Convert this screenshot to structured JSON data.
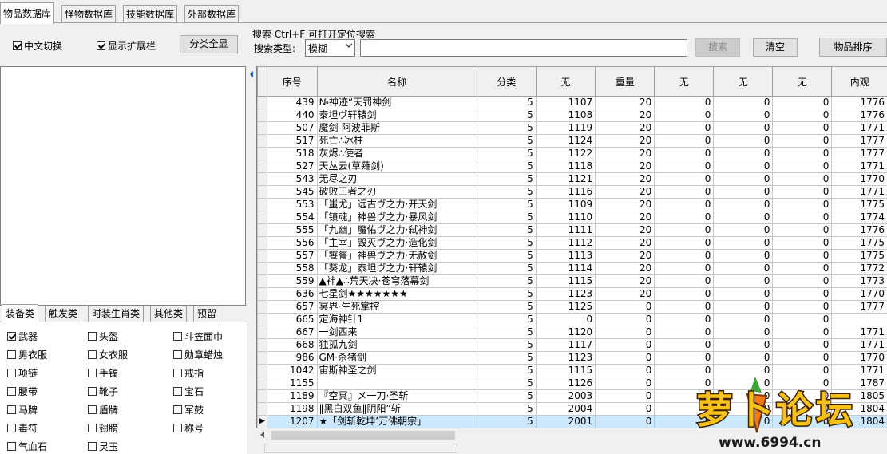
{
  "tabs": [
    {
      "label": "物品数据库",
      "active": true
    },
    {
      "label": "怪物数据库",
      "active": false
    },
    {
      "label": "技能数据库",
      "active": false
    },
    {
      "label": "外部数据库",
      "active": false
    }
  ],
  "toolbar": {
    "chinese_switch": {
      "label": "中文切换",
      "checked": true
    },
    "show_extension": {
      "label": "显示扩展栏",
      "checked": true
    },
    "show_all_label": "分类全显",
    "search_caption": "搜索   Ctrl+F 可打开定位搜索",
    "search_type_label": "搜索类型:",
    "search_type_value": "模糊",
    "search_input_value": "",
    "search_button": "搜索",
    "clear_button": "清空",
    "sort_button": "物品排序"
  },
  "category_tabs": [
    {
      "label": "装备类",
      "active": true
    },
    {
      "label": "触发类",
      "active": false
    },
    {
      "label": "时装生肖类",
      "active": false
    },
    {
      "label": "其他类",
      "active": false
    },
    {
      "label": "预留",
      "active": false
    }
  ],
  "categories": [
    {
      "label": "武器",
      "checked": true
    },
    {
      "label": "头盔",
      "checked": false
    },
    {
      "label": "斗笠面巾",
      "checked": false
    },
    {
      "label": "男衣服",
      "checked": false
    },
    {
      "label": "女衣服",
      "checked": false
    },
    {
      "label": "勋章蜡烛",
      "checked": false
    },
    {
      "label": "项链",
      "checked": false
    },
    {
      "label": "手镯",
      "checked": false
    },
    {
      "label": "戒指",
      "checked": false
    },
    {
      "label": "腰带",
      "checked": false
    },
    {
      "label": "靴子",
      "checked": false
    },
    {
      "label": "宝石",
      "checked": false
    },
    {
      "label": "马牌",
      "checked": false
    },
    {
      "label": "盾牌",
      "checked": false
    },
    {
      "label": "军鼓",
      "checked": false
    },
    {
      "label": "毒符",
      "checked": false
    },
    {
      "label": "翅膀",
      "checked": false
    },
    {
      "label": "称号",
      "checked": false
    },
    {
      "label": "气血石",
      "checked": false
    },
    {
      "label": "灵玉",
      "checked": false
    }
  ],
  "table": {
    "columns": [
      "序号",
      "名称",
      "分类",
      "无",
      "重量",
      "无",
      "无",
      "无",
      "内观"
    ],
    "rows": [
      [
        "439",
        "№神迹“天罚神剑",
        "5",
        "1107",
        "20",
        "0",
        "0",
        "0",
        "1776"
      ],
      [
        "440",
        "泰坦ヴ轩辕剑",
        "5",
        "1108",
        "20",
        "0",
        "0",
        "0",
        "1776"
      ],
      [
        "507",
        "魔剑-阿波菲斯",
        "5",
        "1119",
        "20",
        "0",
        "0",
        "0",
        "1771"
      ],
      [
        "517",
        "死亡∴冰柱",
        "5",
        "1124",
        "20",
        "0",
        "0",
        "0",
        "1777"
      ],
      [
        "518",
        "灰烬∴使者",
        "5",
        "1122",
        "20",
        "0",
        "0",
        "0",
        "1777"
      ],
      [
        "527",
        "天丛云(草薙剑)",
        "5",
        "1118",
        "20",
        "0",
        "0",
        "0",
        "1771"
      ],
      [
        "543",
        "无尽之刃",
        "5",
        "1121",
        "20",
        "0",
        "0",
        "0",
        "1770"
      ],
      [
        "545",
        "破败王者之刃",
        "5",
        "1116",
        "20",
        "0",
        "0",
        "0",
        "1771"
      ],
      [
        "553",
        "「蚩尤」远古ヴ之力·开天剑",
        "5",
        "1109",
        "20",
        "0",
        "0",
        "0",
        "1775"
      ],
      [
        "554",
        "「镇魂」神兽ヴ之力·暴风剑",
        "5",
        "1110",
        "20",
        "0",
        "0",
        "0",
        "1774"
      ],
      [
        "555",
        "「九幽」魔佑ヴ之力·弑神剑",
        "5",
        "1111",
        "20",
        "0",
        "0",
        "0",
        "1776"
      ],
      [
        "556",
        "「主宰」毁灭ヴ之力·造化剑",
        "5",
        "1112",
        "20",
        "0",
        "0",
        "0",
        "1775"
      ],
      [
        "557",
        "「饕餮」神兽ヴ之力·无赦剑",
        "5",
        "1113",
        "20",
        "0",
        "0",
        "0",
        "1775"
      ],
      [
        "558",
        "「葵龙」泰坦ヴ之力·轩辕剑",
        "5",
        "1114",
        "20",
        "0",
        "0",
        "0",
        "1772"
      ],
      [
        "559",
        "▲神▲∴荒天决·苍穹落幕剑",
        "5",
        "1115",
        "20",
        "0",
        "0",
        "0",
        "1773"
      ],
      [
        "636",
        "七星剑★★★★★★★",
        "5",
        "1123",
        "20",
        "0",
        "0",
        "0",
        "1770"
      ],
      [
        "657",
        "冥界·生死掌控",
        "5",
        "1125",
        "0",
        "0",
        "0",
        "0",
        "1777"
      ],
      [
        "665",
        "定海神针1",
        "5",
        "0",
        "0",
        "0",
        "0",
        "0",
        ""
      ],
      [
        "667",
        "一剑西来",
        "5",
        "1120",
        "0",
        "0",
        "0",
        "0",
        "1771"
      ],
      [
        "668",
        "独孤九剑",
        "5",
        "1117",
        "0",
        "0",
        "0",
        "0",
        "1771"
      ],
      [
        "986",
        "GM·杀猪剑",
        "5",
        "1123",
        "0",
        "0",
        "0",
        "0",
        "1770"
      ],
      [
        "1042",
        "宙斯神圣之剑",
        "5",
        "1115",
        "0",
        "0",
        "0",
        "0",
        "1771"
      ],
      [
        "1155",
        "",
        "5",
        "1126",
        "0",
        "0",
        "0",
        "0",
        "1787"
      ],
      [
        "1189",
        "『空冥』メ一刀·圣斩",
        "5",
        "2003",
        "0",
        "0",
        "0",
        "0",
        "1805"
      ],
      [
        "1198",
        "‖黑白双鱼‖阴阳”斩",
        "5",
        "2004",
        "0",
        "0",
        "0",
        "0",
        "1804"
      ],
      [
        "1207",
        "★「剑斩乾坤’万佛朝宗」",
        "5",
        "2001",
        "0",
        "0",
        "0",
        "0",
        "1804"
      ]
    ],
    "selected_row": 25
  },
  "watermark": {
    "text": "萝卜论坛",
    "url_text": "www.6994.cn"
  }
}
